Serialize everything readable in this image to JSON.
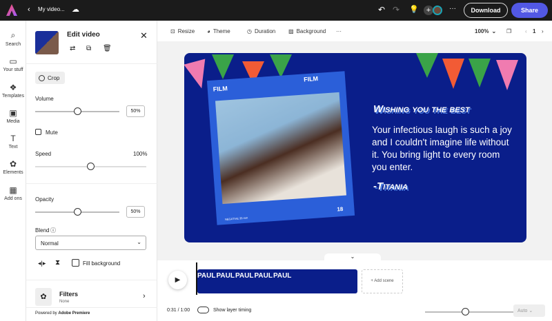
{
  "topbar": {
    "title": "My video...",
    "download": "Download",
    "share": "Share",
    "icons": [
      "adobe-express-logo",
      "back-chevron",
      "cloud",
      "undo",
      "redo",
      "lightbulb",
      "add-collaborator",
      "avatar",
      "more"
    ]
  },
  "rail": [
    {
      "label": "Search",
      "icon": "⌕"
    },
    {
      "label": "Your stuff",
      "icon": "▭"
    },
    {
      "label": "Templates",
      "icon": "❖"
    },
    {
      "label": "Media",
      "icon": "▣"
    },
    {
      "label": "Text",
      "icon": "T"
    },
    {
      "label": "Elements",
      "icon": "✿"
    },
    {
      "label": "Add ons",
      "icon": "▦"
    }
  ],
  "panel": {
    "title": "Edit video",
    "crop": "Crop",
    "volume_label": "Volume",
    "volume_value": "50%",
    "volume": 50,
    "mute": "Mute",
    "speed_label": "Speed",
    "speed_value": "100%",
    "speed": 40,
    "opacity_label": "Opacity",
    "opacity_value": "50%",
    "opacity": 50,
    "blend_label": "Blend",
    "blend_value": "Normal",
    "fill_background": "Fill background",
    "filters_label": "Filters",
    "filters_value": "None",
    "powered": "Powered by",
    "powered_brand": "Adobe Premiere"
  },
  "toolbar": {
    "resize": "Resize",
    "theme": "Theme",
    "duration": "Duration",
    "background": "Background",
    "zoom": "100%",
    "page": "1"
  },
  "card": {
    "heading": "Wishing you the best",
    "body": "Your infectious laugh is such a joy and I couldn't imagine life without it. You bring light to every room you enter.",
    "signature": "-Titania",
    "film1": "FILM",
    "film2": "FILM",
    "frame_number": "18",
    "negative": "NEGATIVE 35 mm",
    "bg": "#0a1e8a"
  },
  "timeline": {
    "time": "0:31 / 1:00",
    "show_layer_timing": "Show layer timing",
    "add_scene": "+ Add scene",
    "clip_text": "PAUL",
    "auto": "Auto",
    "accent": "#5258e4"
  }
}
